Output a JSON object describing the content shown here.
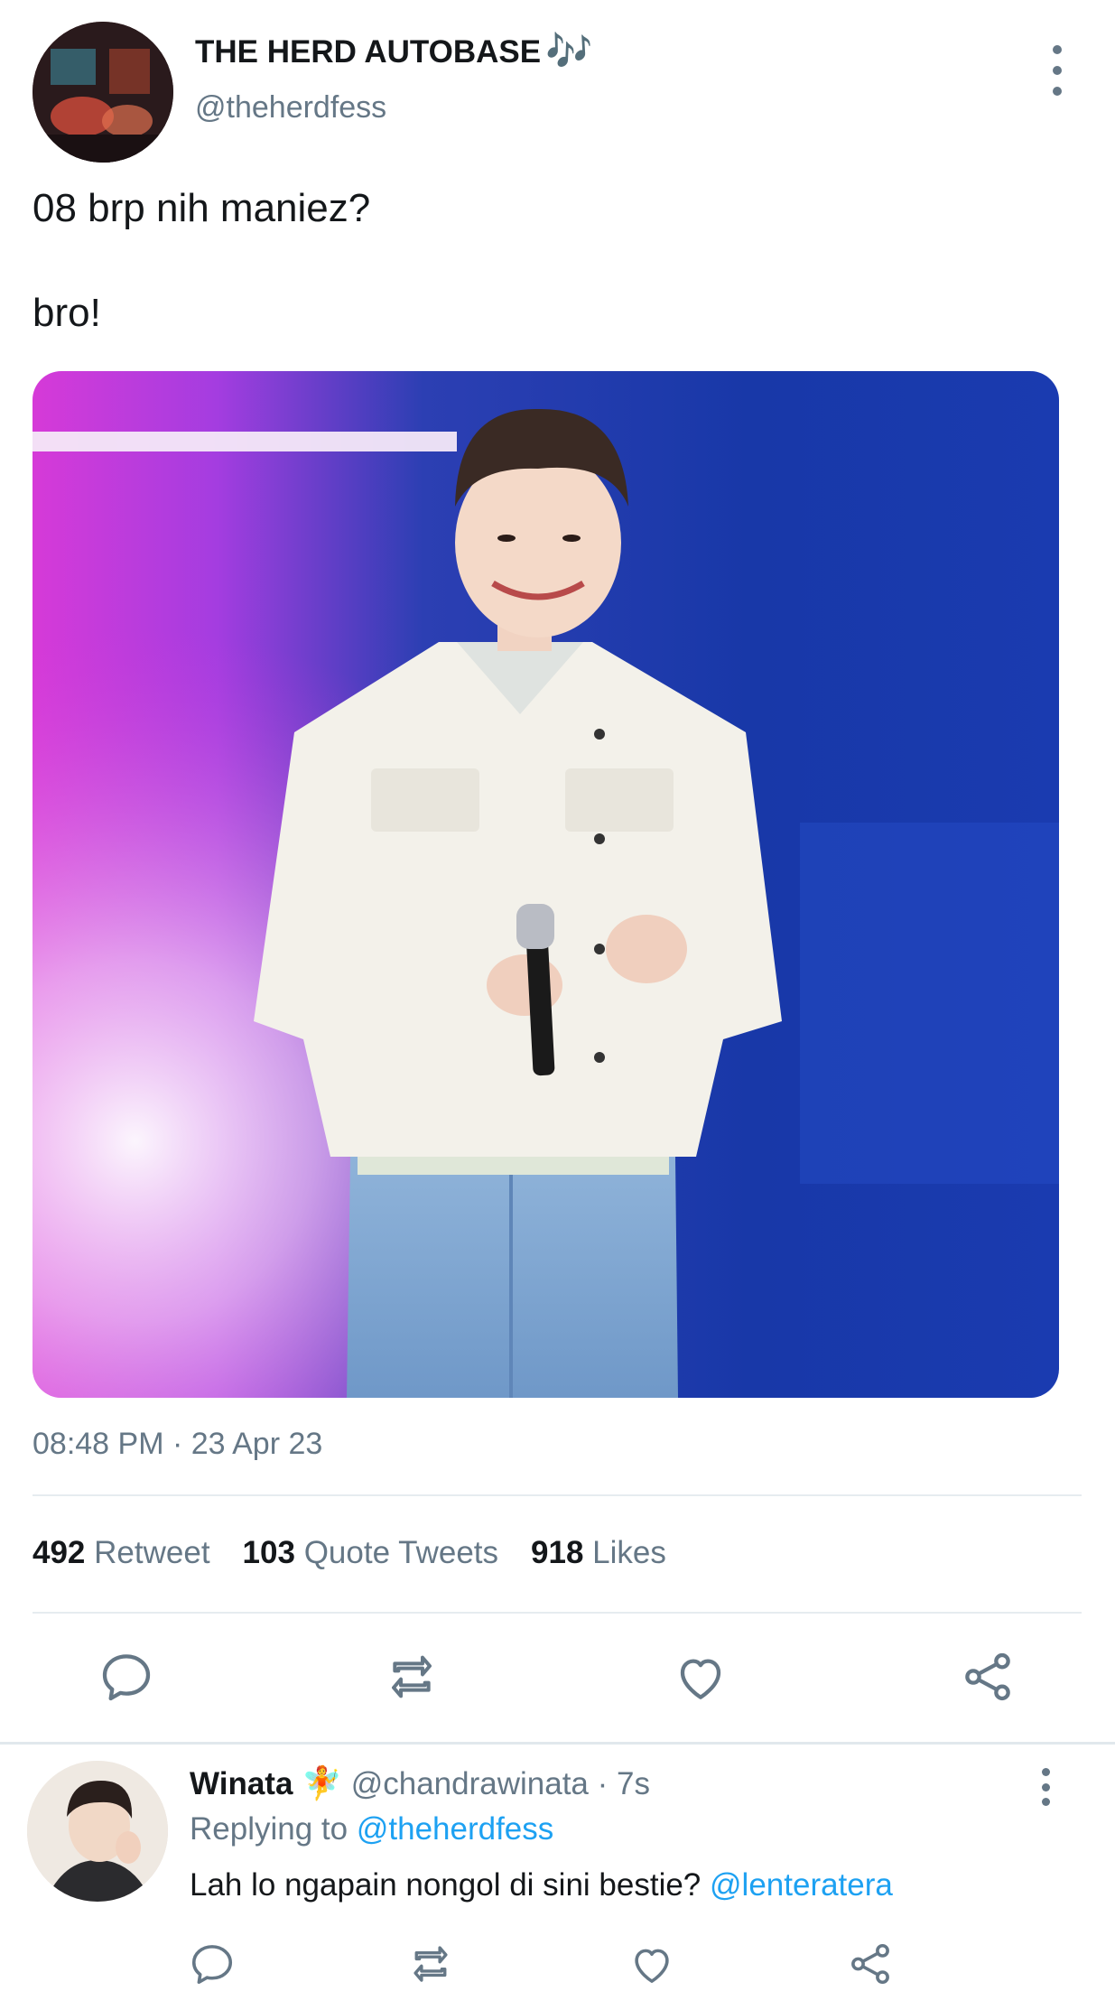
{
  "tweet": {
    "author_name": "THE HERD AUTOBASE",
    "author_emoji": "🎶",
    "author_handle": "@theherdfess",
    "lines": [
      "08 brp nih maniez?",
      "bro!"
    ],
    "timestamp": "08:48 PM · 23 Apr 23",
    "stats": {
      "retweets_count": "492",
      "retweets_label": "Retweet",
      "quotes_count": "103",
      "quotes_label": "Quote Tweets",
      "likes_count": "918",
      "likes_label": "Likes"
    }
  },
  "reply": {
    "author_name": "Winata",
    "author_emoji": "🧚",
    "author_handle": "@chandrawinata",
    "time": "· 7s",
    "replying_prefix": "Replying to",
    "replying_to": "@theherdfess",
    "text": "Lah lo ngapain nongol di sini bestie?",
    "text_mention": "@lenteratera"
  },
  "icons": [
    "more-vertical-icon",
    "reply-icon",
    "retweet-icon",
    "like-icon",
    "share-icon"
  ],
  "colors": {
    "link": "#1da1f2",
    "secondary_text": "#657786",
    "divider": "#e6ecf0"
  }
}
